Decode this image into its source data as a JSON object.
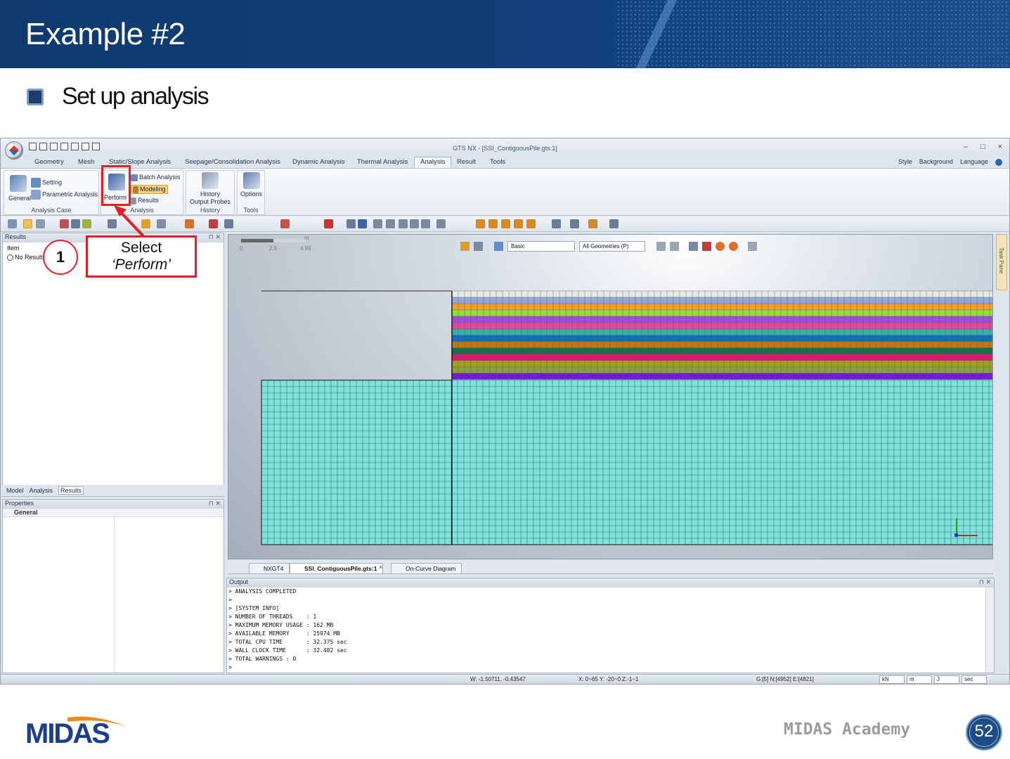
{
  "slide": {
    "title": "Example #2",
    "subtitle": "Set up analysis",
    "footer_brand": "MIDAS Academy",
    "page_number": "52",
    "logo_text": "MIDAS"
  },
  "app": {
    "window_title": "GTS NX - [SSI_ContiguousPile.gts:1]",
    "window_buttons": [
      "–",
      "□",
      "×"
    ],
    "menu_tabs": [
      "Geometry",
      "Mesh",
      "Static/Slope Analysis",
      "Seepage/Consolidation Analysis",
      "Dynamic Analysis",
      "Thermal Analysis",
      "Analysis",
      "Result",
      "Tools"
    ],
    "active_tab": "Analysis",
    "right_menu": [
      "Style",
      "Background",
      "Language"
    ],
    "ribbon": {
      "general": "General",
      "setting": "Setting",
      "parametric": "Parametric Analysis",
      "group_analysis_case": "Analysis Case",
      "perform": "Perform",
      "batch": "Batch Analysis",
      "modeling": "Modeling",
      "results": "Results",
      "group_analysis": "Analysis",
      "history_line1": "History",
      "history_line2": "Output Probes",
      "group_history": "History",
      "options": "Options",
      "group_tools": "Tools"
    },
    "results_panel": {
      "title": "Results",
      "item_header": "Item",
      "item_value": "No Result"
    },
    "panel_tabs": [
      "Model",
      "Analysis",
      "Results"
    ],
    "properties_panel": {
      "title": "Properties",
      "section": "General"
    },
    "viewport": {
      "scale_unit": "m",
      "scale_labels": [
        "0",
        "2.5",
        "4.99"
      ],
      "display_select": "Basic",
      "geometry_select": "All Geometries (P)"
    },
    "task_pane": "Task Pane",
    "doc_tabs": [
      "NXGT4",
      "SSI_ContiguousPile.gts:1",
      "On-Curve Diagram"
    ],
    "output": {
      "title": "Output",
      "lines": [
        "> ANALYSIS COMPLETED",
        ">",
        "> [SYSTEM INFO]",
        "> NUMBER OF THREADS    : 1",
        "> MAXIMUM MEMORY USAGE : 162 MB",
        "> AVAILABLE MEMORY     : 25974 MB",
        "> TOTAL CPU TIME       : 32.375 sec",
        "> WALL CLOCK TIME      : 32.482 sec",
        "> TOTAL WARNINGS : 0",
        ">"
      ]
    },
    "status": {
      "coords_w": "W: -1.50711, -0.43547",
      "coords_xyz": "X: 0~65 Y: -20~0 Z:-1~1",
      "counts": "G:[5] N:[4952] E:[4821]",
      "units": [
        "kN",
        "m",
        "J",
        "sec"
      ]
    }
  },
  "callout": {
    "number": "1",
    "line1": "Select",
    "line2": "‘Perform’"
  },
  "colors": {
    "mesh_soil": "#7fe3dc",
    "mesh_lines": "#2f6f72",
    "highlight": "#e41e26",
    "layers": [
      "#e8e8e8",
      "#8fa8e0",
      "#f0a030",
      "#8ee03a",
      "#a050d8",
      "#e04a9a",
      "#2fb3a5",
      "#1070c0",
      "#c07810",
      "#107050",
      "#e01870",
      "#a0a020",
      "#8aa040",
      "#7a18d8"
    ]
  }
}
